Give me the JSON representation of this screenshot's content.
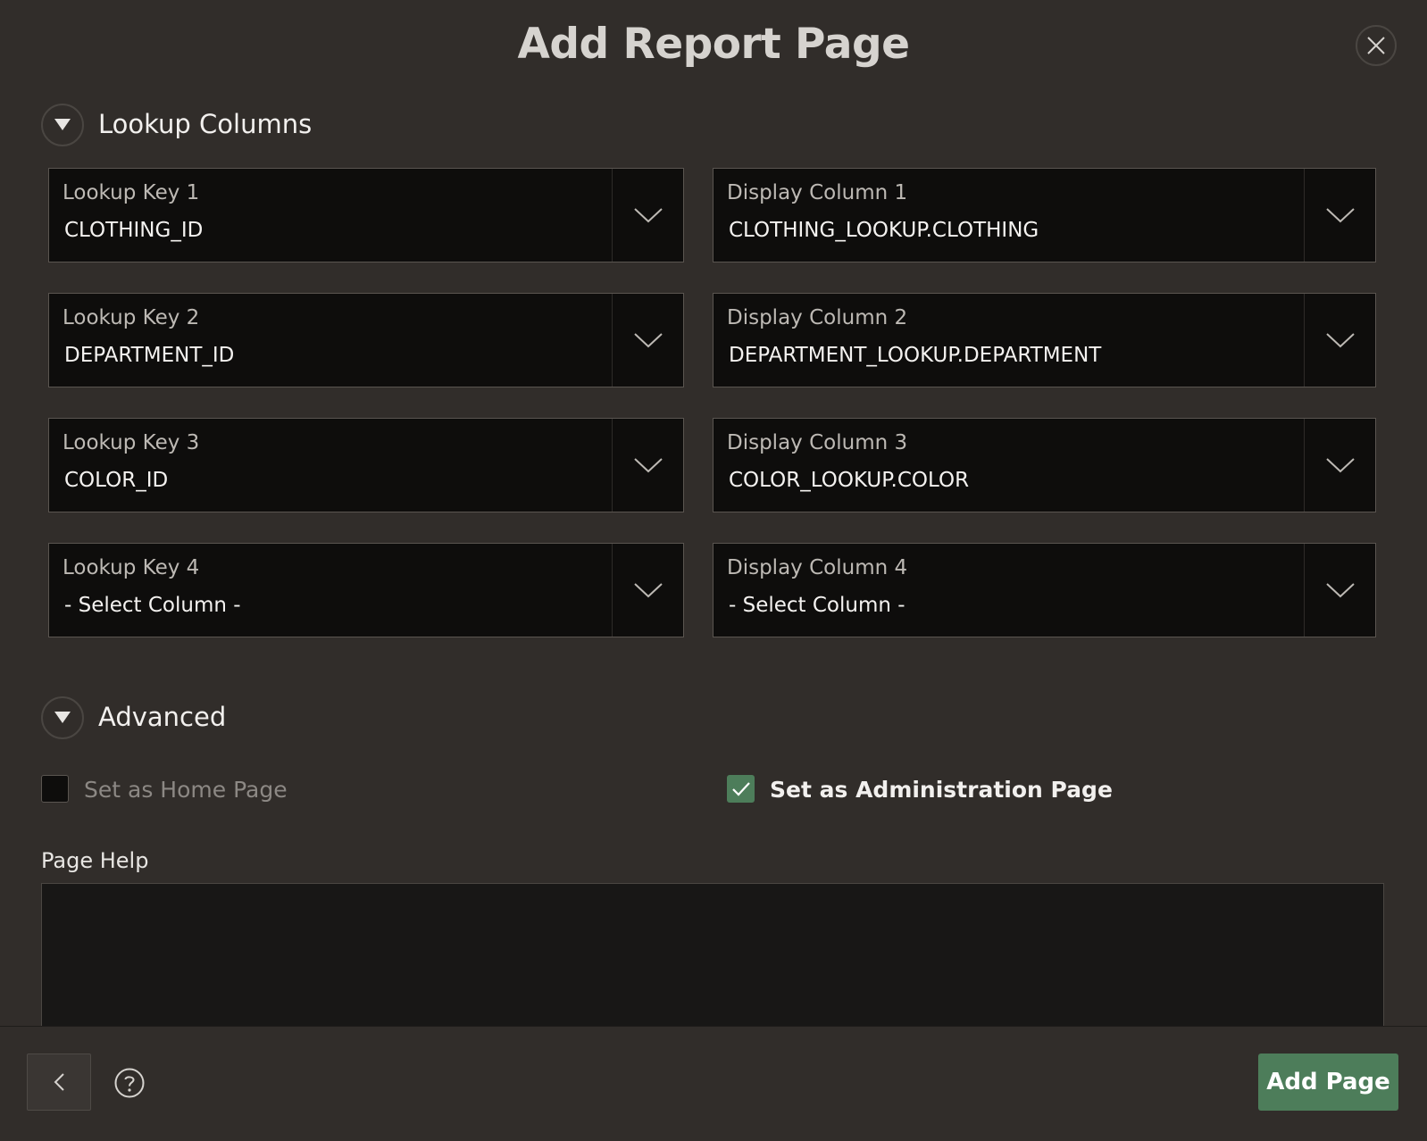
{
  "dialog": {
    "title": "Add Report Page"
  },
  "sections": {
    "lookup": {
      "title": "Lookup Columns"
    },
    "advanced": {
      "title": "Advanced"
    }
  },
  "lookup_keys": [
    {
      "label": "Lookup Key 1",
      "value": "CLOTHING_ID"
    },
    {
      "label": "Lookup Key 2",
      "value": "DEPARTMENT_ID"
    },
    {
      "label": "Lookup Key 3",
      "value": "COLOR_ID"
    },
    {
      "label": "Lookup Key 4",
      "value": "- Select Column -"
    }
  ],
  "display_columns": [
    {
      "label": "Display Column 1",
      "value": "CLOTHING_LOOKUP.CLOTHING"
    },
    {
      "label": "Display Column 2",
      "value": "DEPARTMENT_LOOKUP.DEPARTMENT"
    },
    {
      "label": "Display Column 3",
      "value": "COLOR_LOOKUP.COLOR"
    },
    {
      "label": "Display Column 4",
      "value": "- Select Column -"
    }
  ],
  "options": {
    "home_page": {
      "label": "Set as Home Page",
      "checked": false
    },
    "admin_page": {
      "label": "Set as Administration Page",
      "checked": true
    }
  },
  "page_help": {
    "label": "Page Help",
    "value": ""
  },
  "footer": {
    "add_label": "Add Page"
  },
  "colors": {
    "accent": "#4d7d5a",
    "background": "#312d2a",
    "field_bg": "#0e0d0c"
  }
}
